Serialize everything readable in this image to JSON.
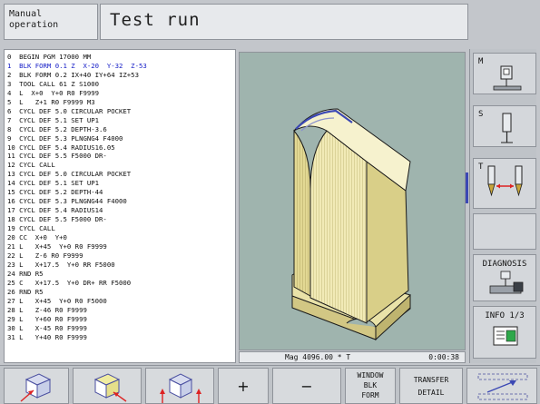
{
  "header": {
    "mode_label": "Manual operation",
    "title": "Test run"
  },
  "program": {
    "lines": [
      "0  BEGIN PGM 17000 MM",
      "1  BLK FORM 0.1 Z  X-20  Y-32  Z-53",
      "2  BLK FORM 0.2 IX+40 IY+64 IZ+53",
      "3  TOOL CALL 61 Z S1000",
      "4  L  X+0  Y+0 R0 F9999",
      "5  L   Z+1 R0 F9999 M3",
      "6  CYCL DEF 5.0 CIRCULAR POCKET",
      "7  CYCL DEF 5.1 SET UP1",
      "8  CYCL DEF 5.2 DEPTH-3.6",
      "9  CYCL DEF 5.3 PLNGNG4 F4000",
      "10 CYCL DEF 5.4 RADIUS16.05",
      "11 CYCL DEF 5.5 F5000 DR-",
      "12 CYCL CALL",
      "13 CYCL DEF 5.0 CIRCULAR POCKET",
      "14 CYCL DEF 5.1 SET UP1",
      "15 CYCL DEF 5.2 DEPTH-44",
      "16 CYCL DEF 5.3 PLNGNG44 F4000",
      "17 CYCL DEF 5.4 RADIUS14",
      "18 CYCL DEF 5.5 F5000 DR-",
      "19 CYCL CALL",
      "20 CC  X+0  Y+0",
      "21 L   X+45  Y+0 R0 F9999",
      "22 L   Z-6 R0 F9999",
      "23 L   X+17.5  Y+0 RR F5000",
      "24 RND R5",
      "25 C   X+17.5  Y+0 DR+ RR F5000",
      "26 RND R5",
      "27 L   X+45  Y+0 R0 F5000",
      "28 L   Z-46 R0 F9999",
      "29 L   Y+60 R0 F9999",
      "30 L   X-45 R0 F9999",
      "31 L   Y+40 R0 F9999"
    ],
    "active_line_index": 1,
    "active_color": "#1a22c8"
  },
  "status": {
    "magnification": "Mag 4096.00 * T",
    "time": "0:00:38"
  },
  "side_keys": {
    "m_label": "M",
    "s_label": "S",
    "t_label": "T",
    "diagnosis_label": "DIAGNOSIS",
    "info_label": "INFO 1/3"
  },
  "softkeys": {
    "plus": "+",
    "minus": "−",
    "window_blk_form": [
      "WINDOW",
      "BLK",
      "FORM"
    ],
    "transfer_detail": [
      "TRANSFER",
      "DETAIL"
    ]
  },
  "colors": {
    "graphics_bg": "#9fb4ae",
    "part_fill": "#f3edb8",
    "part_shadow": "#d8cf88",
    "accent_blue": "#3b48b4"
  }
}
